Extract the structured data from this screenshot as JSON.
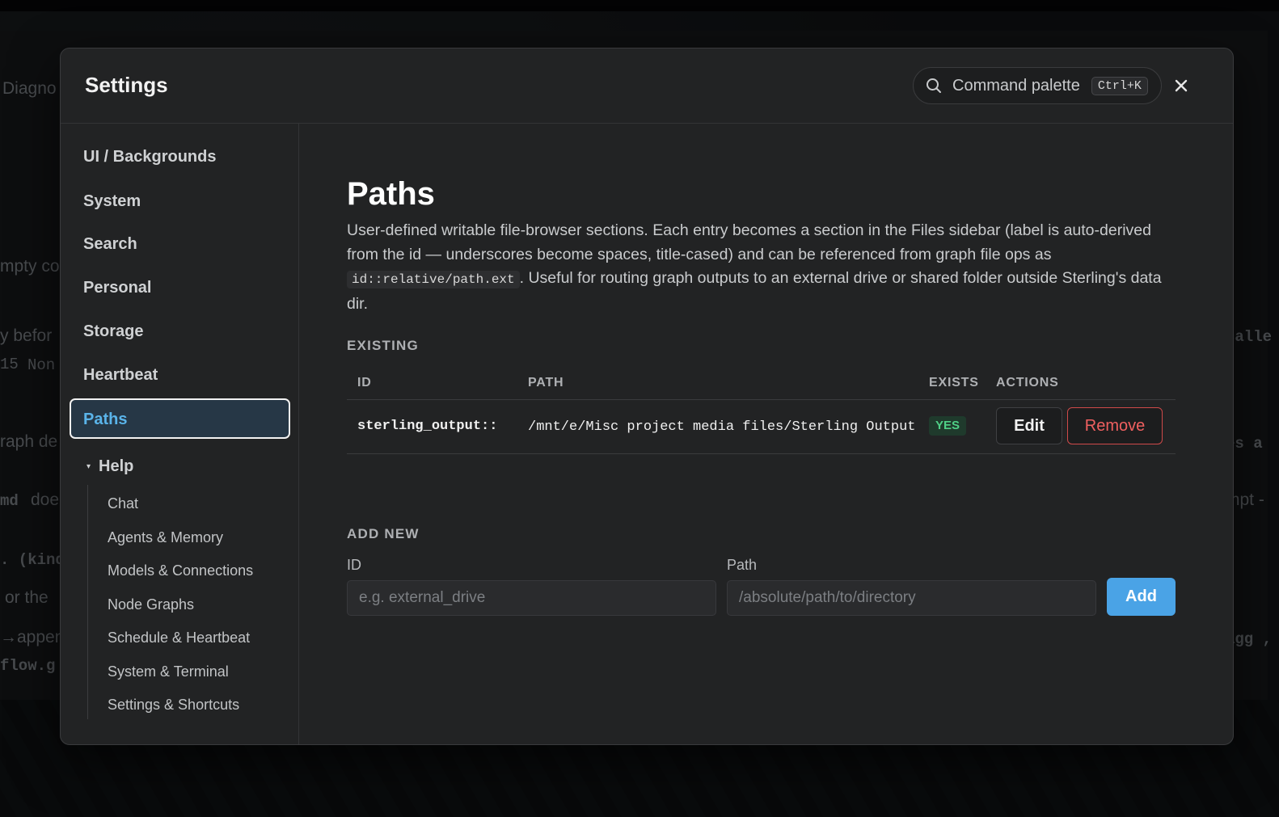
{
  "background": {
    "fragments": [
      {
        "text": "Diagno"
      },
      {
        "text": "mpty co"
      },
      {
        "text": "y befor"
      },
      {
        "text": "15"
      },
      {
        "text": "Non"
      },
      {
        "text": "raph de"
      },
      {
        "text": "md"
      },
      {
        "text": "doe"
      },
      {
        "text": ". (kind"
      },
      {
        "text": "or the"
      },
      {
        "text": "→appen"
      },
      {
        "text": "flow.g"
      },
      {
        "text": "calle"
      },
      {
        "text": "es a"
      },
      {
        "text": "mpt -"
      },
      {
        "text": "agg , c"
      }
    ]
  },
  "modal": {
    "title": "Settings",
    "command_palette": {
      "label": "Command palette",
      "shortcut": "Ctrl+K",
      "icon": "search-icon"
    },
    "close_icon": "close-icon"
  },
  "sidebar": {
    "items": [
      {
        "label": "UI / Backgrounds"
      },
      {
        "label": "System"
      },
      {
        "label": "Search"
      },
      {
        "label": "Personal"
      },
      {
        "label": "Storage"
      },
      {
        "label": "Heartbeat"
      },
      {
        "label": "Paths",
        "active": true
      }
    ],
    "help": {
      "label": "Help",
      "expanded": true,
      "items": [
        {
          "label": "Chat"
        },
        {
          "label": "Agents & Memory"
        },
        {
          "label": "Models & Connections"
        },
        {
          "label": "Node Graphs"
        },
        {
          "label": "Schedule & Heartbeat"
        },
        {
          "label": "System & Terminal"
        },
        {
          "label": "Settings & Shortcuts"
        }
      ]
    }
  },
  "content": {
    "title": "Paths",
    "description": {
      "part1": "User-defined writable file-browser sections. Each entry becomes a section in the Files sidebar (label is auto-derived from the id — underscores become spaces, title-cased) and can be referenced from graph file ops as ",
      "code": "id::relative/path.ext",
      "part2": ". Useful for routing graph outputs to an external drive or shared folder outside Sterling's data dir."
    },
    "existing": {
      "label": "EXISTING",
      "columns": [
        "ID",
        "PATH",
        "EXISTS",
        "ACTIONS"
      ],
      "rows": [
        {
          "id": "sterling_output::",
          "path": "/mnt/e/Misc project media files/Sterling Output",
          "exists": "YES",
          "edit_label": "Edit",
          "remove_label": "Remove"
        }
      ]
    },
    "add_new": {
      "label": "ADD NEW",
      "id_label": "ID",
      "id_placeholder": "e.g. external_drive",
      "path_label": "Path",
      "path_placeholder": "/absolute/path/to/directory",
      "add_label": "Add"
    }
  },
  "colors": {
    "accent": "#4aa3e6",
    "active_nav_text": "#5ab4ea",
    "danger": "#f06060",
    "success": "#4fcf86",
    "modal_bg": "#222324"
  }
}
